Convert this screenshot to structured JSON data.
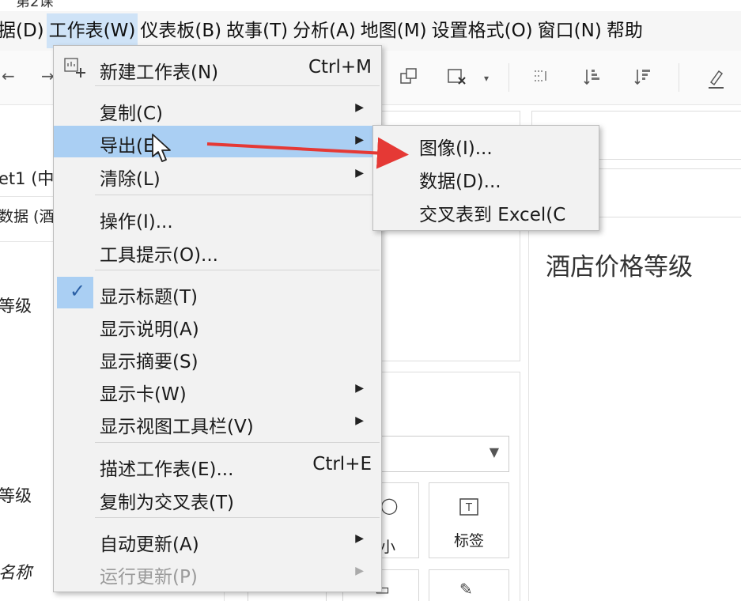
{
  "window": {
    "title": "第2课"
  },
  "menubar": {
    "items": [
      {
        "label": "据(D)"
      },
      {
        "label": "工作表(W)",
        "active": true
      },
      {
        "label": "仪表板(B)"
      },
      {
        "label": "故事(T)"
      },
      {
        "label": "分析(A)"
      },
      {
        "label": "地图(M)"
      },
      {
        "label": "设置格式(O)"
      },
      {
        "label": "窗口(N)"
      },
      {
        "label": "帮助"
      }
    ]
  },
  "toolbar": {
    "icons": [
      "undo-icon",
      "redo-icon",
      "duplicate-sheet-icon",
      "clear-sheet-icon",
      "group-icon",
      "sort-ascending-icon",
      "sort-descending-icon",
      "highlight-icon"
    ]
  },
  "left_panel": {
    "sheet_name": "et1 (中",
    "datasource": "数据 (酒",
    "field_1": "等级",
    "field_2": "等级",
    "field_3": "名称"
  },
  "worksheet_menu": {
    "items": [
      {
        "label": "新建工作表(N)",
        "shortcut": "Ctrl+M",
        "icon": "new-worksheet-icon"
      },
      {
        "label": "复制(C)",
        "submenu": true
      },
      {
        "label": "导出(E)",
        "submenu": true,
        "highlighted": true
      },
      {
        "label": "清除(L)",
        "submenu": true
      },
      {
        "label": "操作(I)..."
      },
      {
        "label": "工具提示(O)..."
      },
      {
        "label": "显示标题(T)",
        "checked": true
      },
      {
        "label": "显示说明(A)"
      },
      {
        "label": "显示摘要(S)"
      },
      {
        "label": "显示卡(W)",
        "submenu": true
      },
      {
        "label": "显示视图工具栏(V)",
        "submenu": true
      },
      {
        "label": "描述工作表(E)...",
        "shortcut": "Ctrl+E"
      },
      {
        "label": "复制为交叉表(T)"
      },
      {
        "label": "自动更新(A)",
        "submenu": true
      },
      {
        "label": "运行更新(P)",
        "submenu": true,
        "disabled": true
      }
    ]
  },
  "export_submenu": {
    "items": [
      {
        "label": "图像(I)..."
      },
      {
        "label": "数据(D)..."
      },
      {
        "label": "交叉表到 Excel(C"
      }
    ]
  },
  "marks_card": {
    "size_label": "小",
    "label_label": "标签",
    "label_icon": "T"
  },
  "view": {
    "sheet_title": "酒店价格等级"
  },
  "colors": {
    "highlight": "#aacff3",
    "annotation_arrow": "#e53935",
    "menu_bg": "#f2f2f2"
  }
}
